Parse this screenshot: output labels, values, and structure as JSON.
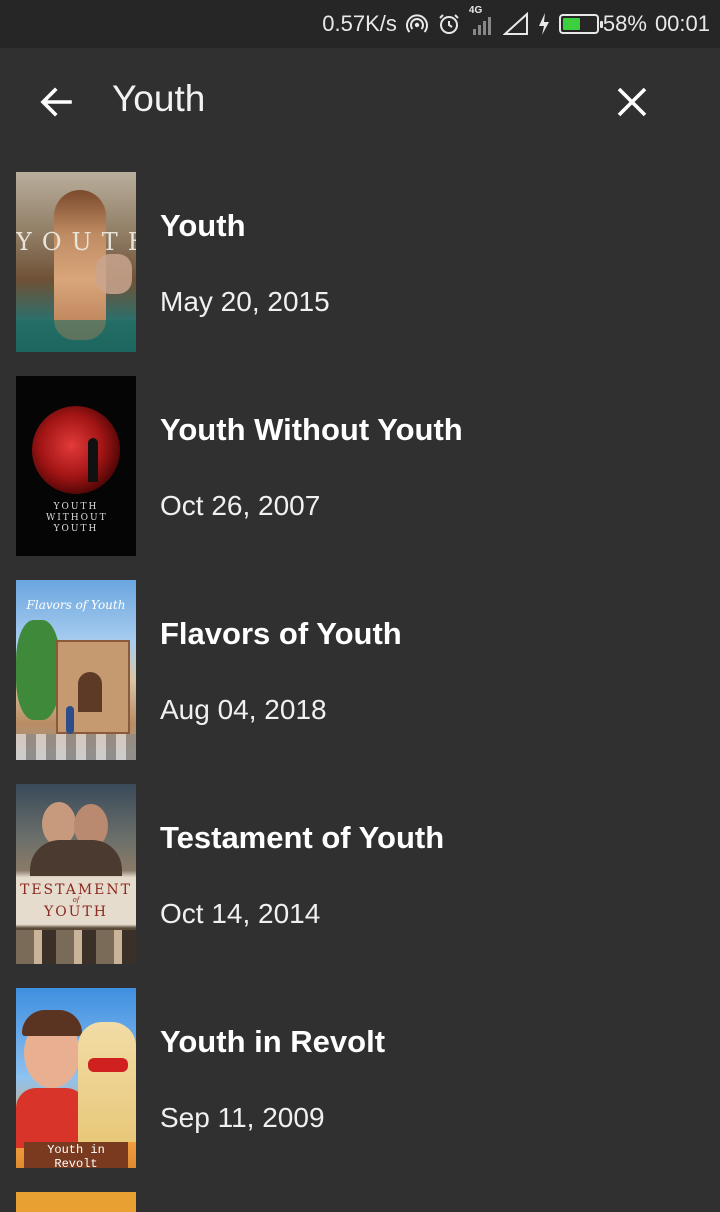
{
  "status_bar": {
    "speed": "0.57K/s",
    "network_badge": "4G",
    "battery": "58%",
    "battery_level": 0.58,
    "time": "00:01",
    "icons": [
      "hotspot-icon",
      "alarm-icon",
      "signal-4g-icon",
      "cell-signal-icon",
      "charging-icon",
      "battery-icon"
    ]
  },
  "search": {
    "back_icon": "arrow-left-icon",
    "query": "Youth",
    "clear_icon": "close-icon"
  },
  "results": [
    {
      "title": "Youth",
      "date": "May 20, 2015",
      "poster_text": "YOUTH"
    },
    {
      "title": "Youth Without Youth",
      "date": "Oct 26, 2007",
      "poster_text": "YOUTH WITHOUT YOUTH"
    },
    {
      "title": "Flavors of Youth",
      "date": "Aug 04, 2018",
      "poster_text": "Flavors of Youth"
    },
    {
      "title": "Testament of Youth",
      "date": "Oct 14, 2014",
      "poster_text_1": "TESTAMENT",
      "poster_text_2": "of",
      "poster_text_3": "YOUTH"
    },
    {
      "title": "Youth in Revolt",
      "date": "Sep 11, 2009",
      "poster_text": "Youth in Revolt"
    }
  ]
}
